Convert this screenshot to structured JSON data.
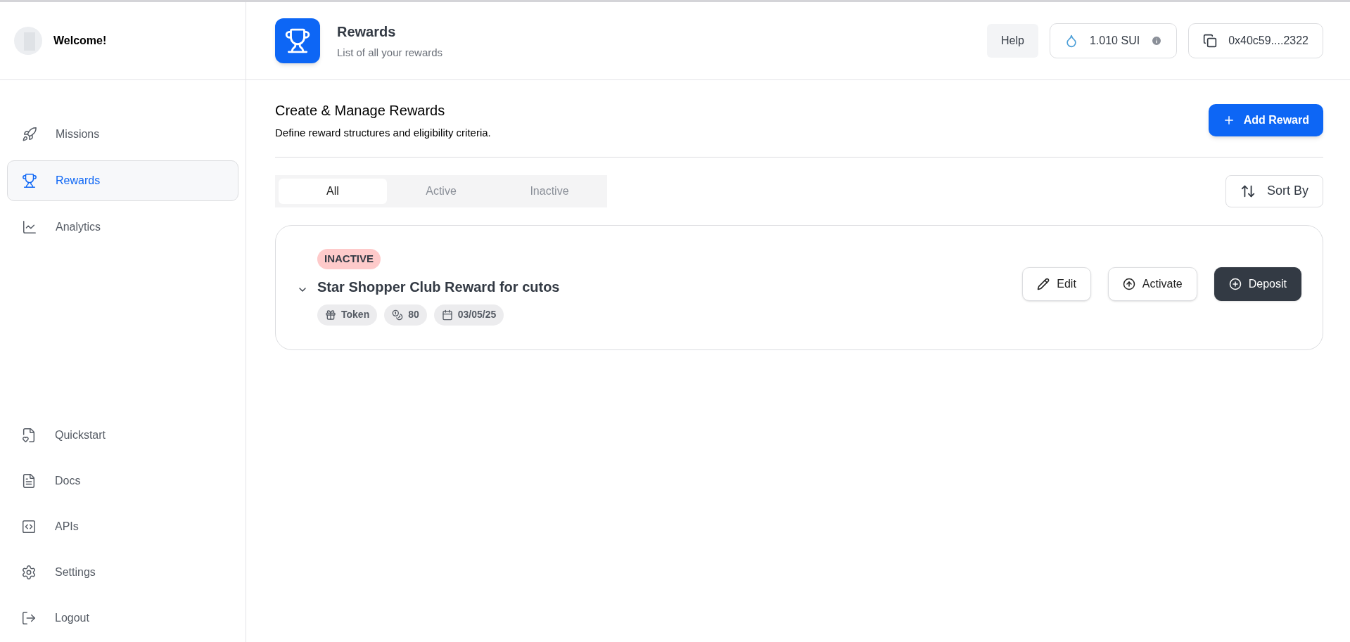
{
  "sidebar": {
    "welcome": "Welcome!",
    "nav": [
      {
        "label": "Missions",
        "selected": false
      },
      {
        "label": "Rewards",
        "selected": true
      },
      {
        "label": "Analytics",
        "selected": false
      }
    ],
    "bottom_nav": [
      {
        "label": "Quickstart"
      },
      {
        "label": "Docs"
      },
      {
        "label": "APIs"
      },
      {
        "label": "Settings"
      },
      {
        "label": "Logout"
      }
    ]
  },
  "header": {
    "title": "Rewards",
    "subtitle": "List of all your rewards",
    "help": "Help",
    "balance": "1.010 SUI",
    "address": "0x40c59....2322"
  },
  "section": {
    "title": "Create & Manage Rewards",
    "subtitle": "Define reward structures and eligibility criteria.",
    "add_button": "Add Reward"
  },
  "tabs": [
    {
      "label": "All",
      "selected": true
    },
    {
      "label": "Active",
      "selected": false
    },
    {
      "label": "Inactive",
      "selected": false
    }
  ],
  "sort_button": "Sort By",
  "rewards": [
    {
      "status": "INACTIVE",
      "title": "Star Shopper Club Reward for cutos",
      "expanded": false,
      "chips": [
        "Token",
        "80",
        "03/05/25"
      ],
      "actions": [
        {
          "label": "Edit",
          "kind": "outline"
        },
        {
          "label": "Activate",
          "kind": "outline"
        },
        {
          "label": "Deposit",
          "kind": "dark"
        }
      ]
    }
  ]
}
